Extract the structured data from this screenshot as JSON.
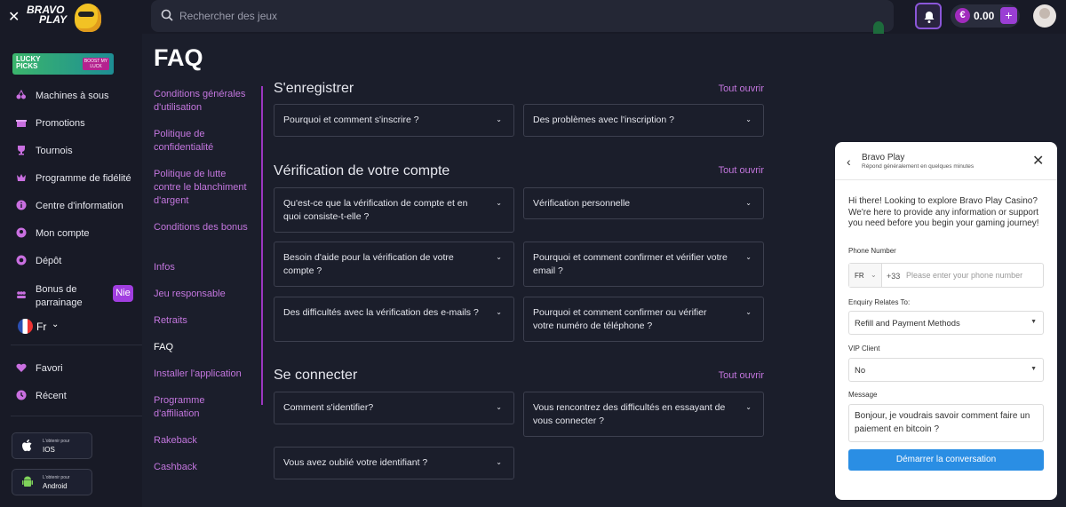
{
  "topbar": {
    "logo_line1": "BRAVO",
    "logo_line2": "PLAY",
    "search_placeholder": "Rechercher des jeux",
    "balance": "0.00",
    "currency_symbol": "€",
    "add_label": "+"
  },
  "sidebar": {
    "promo_banner": {
      "line1": "LUCKY",
      "line2": "PICKS",
      "badge": "BOOST MY LUCK"
    },
    "items": [
      {
        "label": "Machines à sous",
        "icon": "slot-machine-icon"
      },
      {
        "label": "Promotions",
        "icon": "gift-icon"
      },
      {
        "label": "Tournois",
        "icon": "trophy-icon"
      },
      {
        "label": "Programme de fidélité",
        "icon": "crown-icon"
      },
      {
        "label": "Centre d'information",
        "icon": "info-icon"
      },
      {
        "label": "Mon compte",
        "icon": "user-icon"
      },
      {
        "label": "Dépôt",
        "icon": "wallet-icon"
      },
      {
        "label": "Bonus de parrainage",
        "icon": "referral-icon",
        "badge": "Nie"
      }
    ],
    "language": "Fr",
    "secondary_items": [
      {
        "label": "Favori",
        "icon": "heart-icon"
      },
      {
        "label": "Récent",
        "icon": "recent-icon"
      }
    ],
    "stores": [
      {
        "small": "L'obtenir pour",
        "name": "IOS",
        "icon": "apple-icon"
      },
      {
        "small": "L'obtenir pour",
        "name": "Android",
        "icon": "android-icon"
      }
    ]
  },
  "faq": {
    "title": "FAQ",
    "categories": [
      "Conditions générales d'utilisation",
      "Politique de confidentialité",
      "Politique de lutte contre le blanchiment d'argent",
      "Conditions des bonus",
      "Infos",
      "Jeu responsable",
      "Retraits",
      "FAQ",
      "Installer l'application",
      "Programme d'affiliation",
      "Rakeback",
      "Cashback"
    ],
    "active_category": "FAQ",
    "sections": [
      {
        "title": "S'enregistrer",
        "open_all": "Tout ouvrir",
        "questions": [
          "Pourquoi et comment s'inscrire ?",
          "Des problèmes avec l'inscription ?"
        ]
      },
      {
        "title": "Vérification de votre compte",
        "open_all": "Tout ouvrir",
        "questions": [
          "Qu'est-ce que la vérification de compte et en quoi consiste-t-elle ?",
          "Vérification personnelle",
          "Besoin d'aide pour la vérification de votre compte ?",
          "Pourquoi et comment confirmer et vérifier votre email ?",
          "Des difficultés avec la vérification des e-mails ?",
          "Pourquoi et comment confirmer ou vérifier votre numéro de téléphone ?"
        ]
      },
      {
        "title": "Se connecter",
        "open_all": "Tout ouvrir",
        "questions": [
          "Comment s'identifier?",
          "Vous rencontrez des difficultés en essayant de vous connecter ?",
          "Vous avez oublié votre identifiant ?"
        ]
      }
    ]
  },
  "chat": {
    "name": "Bravo Play",
    "subtitle": "Répond généralement en quelques minutes",
    "greeting": "Hi there! Looking to explore Bravo Play Casino? We're here to provide any information or support you need before you begin your gaming journey!",
    "phone_label": "Phone Number",
    "country_code": "FR",
    "dial_code": "+33",
    "phone_placeholder": "Please enter your phone number",
    "enquiry_label": "Enquiry Relates To:",
    "enquiry_value": "Refill and Payment Methods",
    "vip_label": "VIP Client",
    "vip_value": "No",
    "message_label": "Message",
    "message_value": "Bonjour, je voudrais savoir comment faire un paiement en bitcoin ?",
    "start_button": "Démarrer la conversation"
  }
}
